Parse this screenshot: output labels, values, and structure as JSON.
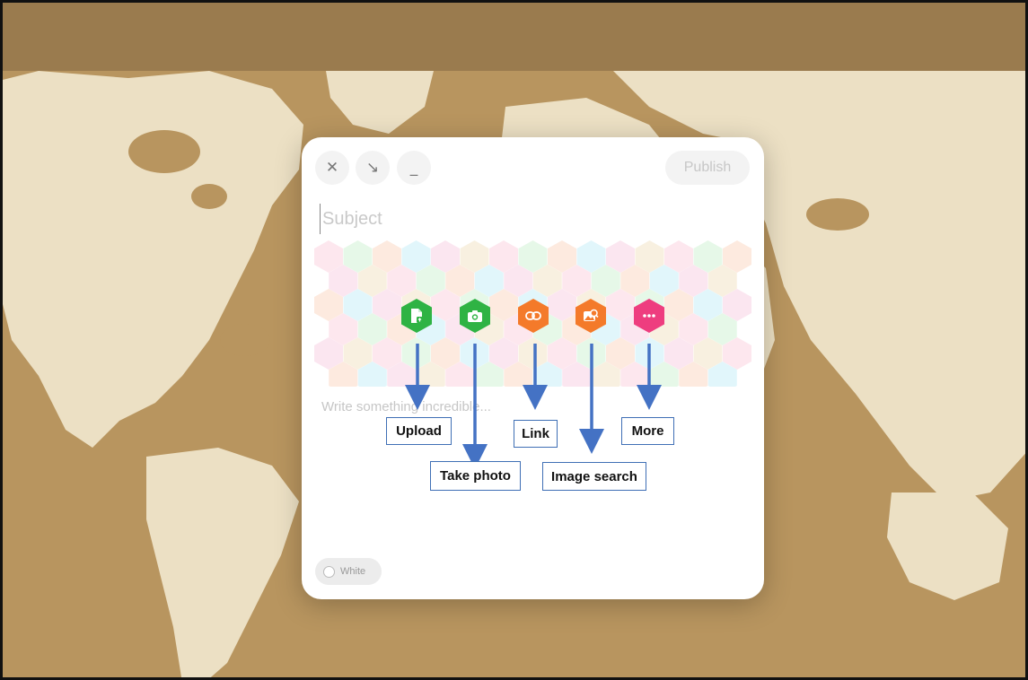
{
  "modal": {
    "toolbar": {
      "close_icon": "close-icon",
      "collapse_icon": "arrow-down-right-icon",
      "minimize_icon": "minimize-icon",
      "publish_label": "Publish"
    },
    "subject_placeholder": "Subject",
    "body_placeholder": "Write something incredible...",
    "color_option": "White",
    "attachment_actions": [
      {
        "name": "upload",
        "icon": "upload-file-icon",
        "color": "#2fb344"
      },
      {
        "name": "take-photo",
        "icon": "camera-icon",
        "color": "#2fb344"
      },
      {
        "name": "link",
        "icon": "link-icon",
        "color": "#f47a2a"
      },
      {
        "name": "image-search",
        "icon": "image-search-icon",
        "color": "#f47a2a"
      },
      {
        "name": "more",
        "icon": "more-dots-icon",
        "color": "#ee3d7f"
      }
    ]
  },
  "annotations": {
    "upload": "Upload",
    "take_photo": "Take photo",
    "link": "Link",
    "image_search": "Image search",
    "more": "More"
  },
  "colors": {
    "background_top_bar": "#9a7b4e",
    "map_land": "#ece0c4",
    "map_sea": "#b8955f",
    "annotation_arrow": "#4472c4"
  }
}
